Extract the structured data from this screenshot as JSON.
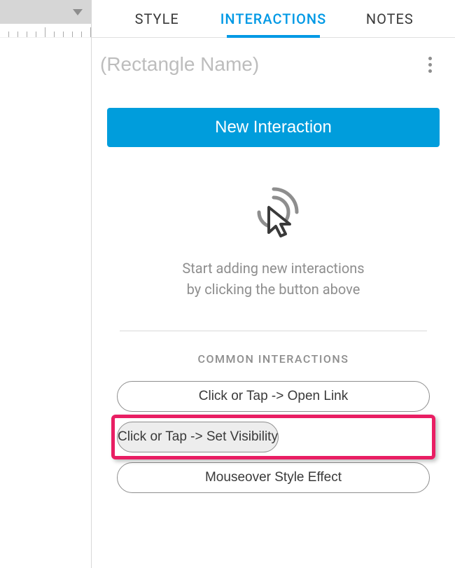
{
  "tabs": {
    "style": "STYLE",
    "interactions": "INTERACTIONS",
    "notes": "NOTES"
  },
  "name_row": {
    "placeholder": "(Rectangle Name)"
  },
  "primary_button": "New Interaction",
  "hint": {
    "line1": "Start adding new interactions",
    "line2": "by clicking the button above"
  },
  "common_section": {
    "title": "COMMON INTERACTIONS",
    "items": [
      "Click or Tap -> Open Link",
      "Click or Tap -> Set Visibility",
      "Mouseover Style Effect"
    ]
  }
}
